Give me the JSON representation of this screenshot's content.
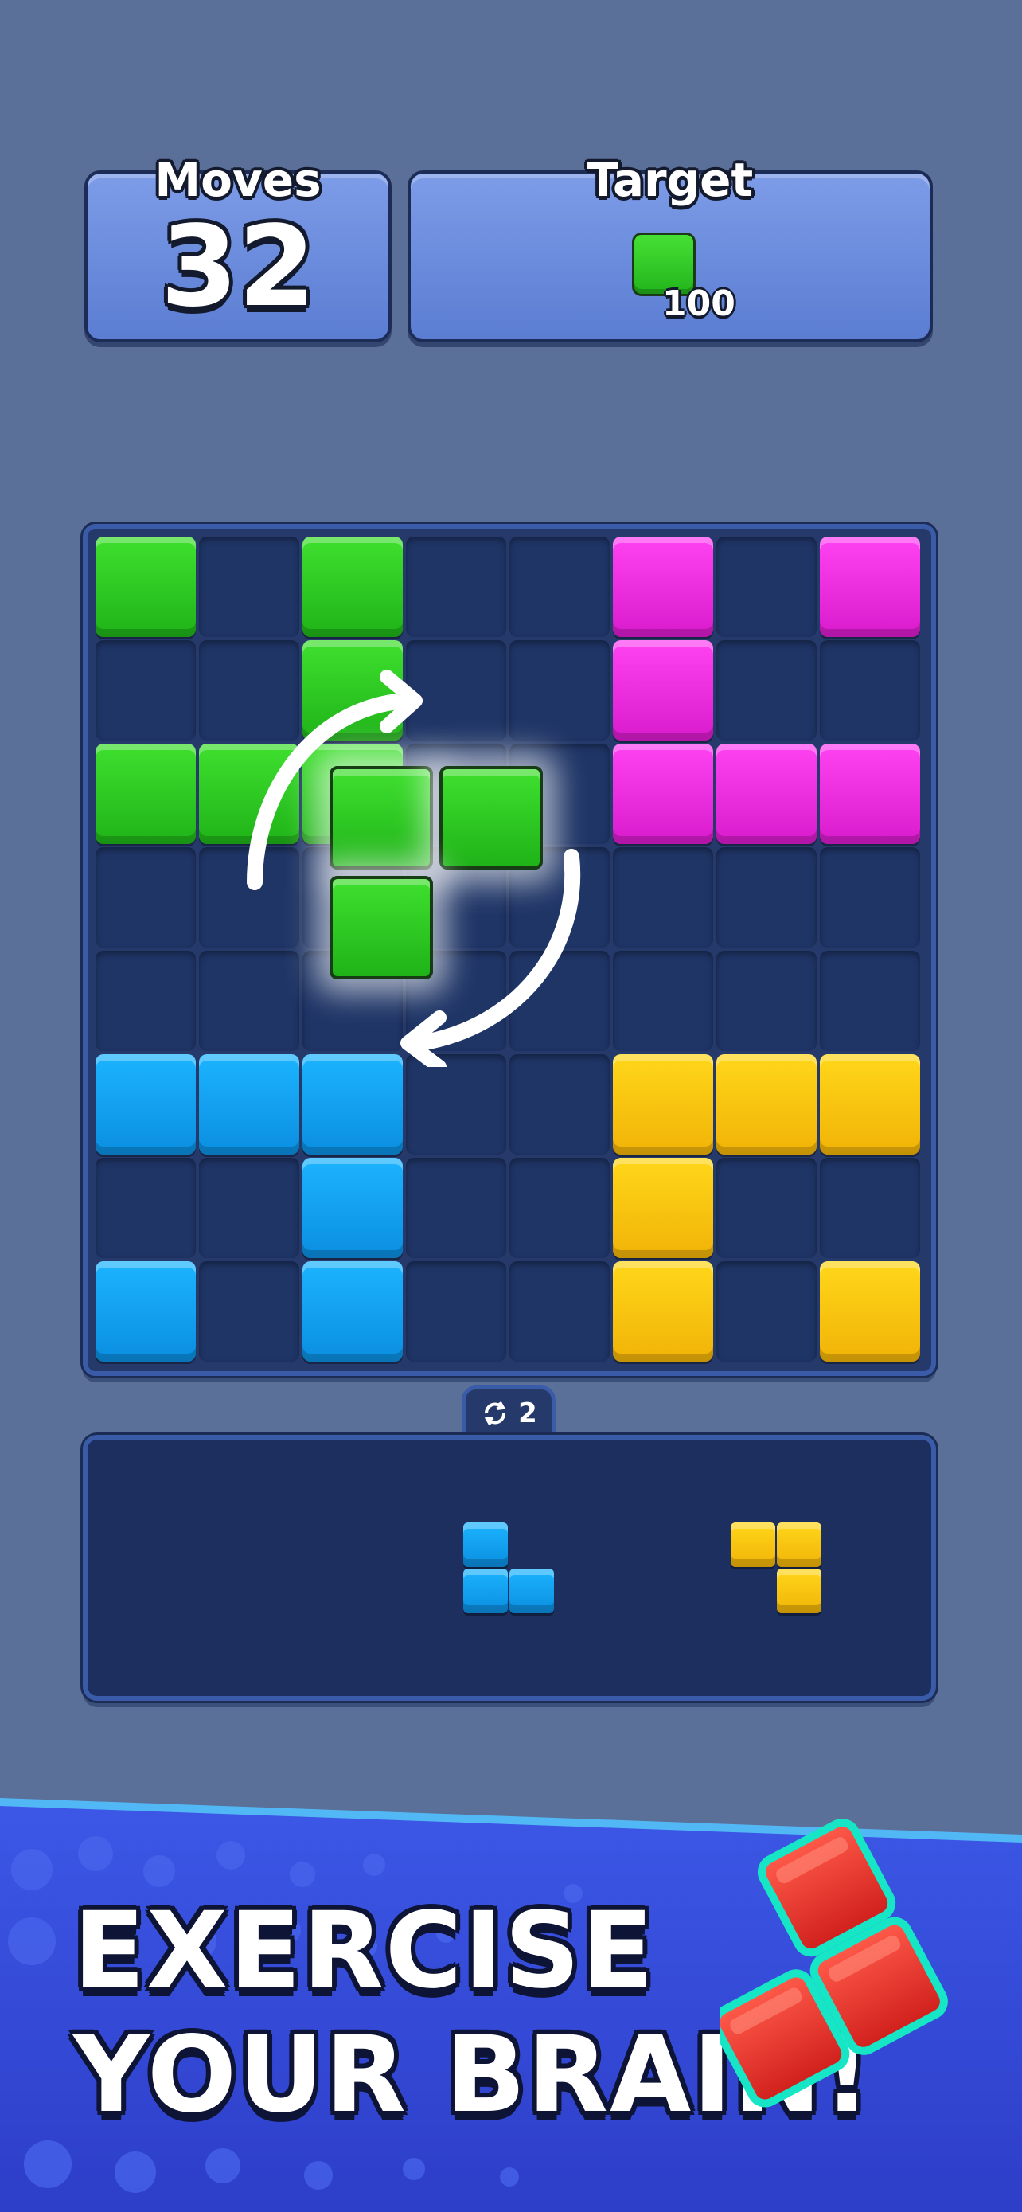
{
  "hud": {
    "moves_label": "Moves",
    "moves_value": "32",
    "target_label": "Target",
    "target_color": "green",
    "target_count": "100"
  },
  "board": {
    "columns": 8,
    "rows": 8,
    "grid": [
      [
        "green",
        "empty",
        "green",
        "empty",
        "empty",
        "magenta",
        "empty",
        "magenta"
      ],
      [
        "empty",
        "empty",
        "green",
        "empty",
        "empty",
        "magenta",
        "empty",
        "empty"
      ],
      [
        "green",
        "green",
        "green",
        "empty",
        "empty",
        "magenta",
        "magenta",
        "magenta"
      ],
      [
        "empty",
        "empty",
        "empty",
        "empty",
        "empty",
        "empty",
        "empty",
        "empty"
      ],
      [
        "empty",
        "empty",
        "empty",
        "empty",
        "empty",
        "empty",
        "empty",
        "empty"
      ],
      [
        "blue",
        "blue",
        "blue",
        "empty",
        "empty",
        "yellow",
        "yellow",
        "yellow"
      ],
      [
        "empty",
        "empty",
        "blue",
        "empty",
        "empty",
        "yellow",
        "empty",
        "empty"
      ],
      [
        "blue",
        "empty",
        "blue",
        "empty",
        "empty",
        "yellow",
        "empty",
        "yellow"
      ]
    ],
    "active_piece_color": "green",
    "rotate_hint_icon": "rotate-arrows-icon"
  },
  "tray": {
    "rotate_count": "2",
    "rotate_icon": "refresh-icon",
    "pieces": [
      {
        "color": "blue"
      },
      {
        "color": "yellow"
      }
    ]
  },
  "banner": {
    "line1": "EXERCISE",
    "line2": "YOUR BRAIN!",
    "decor_piece_color": "red"
  },
  "colors": {
    "background": "#5b7098",
    "board": "#253a6a",
    "green": "#2ecb22",
    "magenta": "#f02ee4",
    "blue": "#12a3f5",
    "yellow": "#fcc70f",
    "red": "#e8322c",
    "banner_blue": "#3346d8"
  }
}
